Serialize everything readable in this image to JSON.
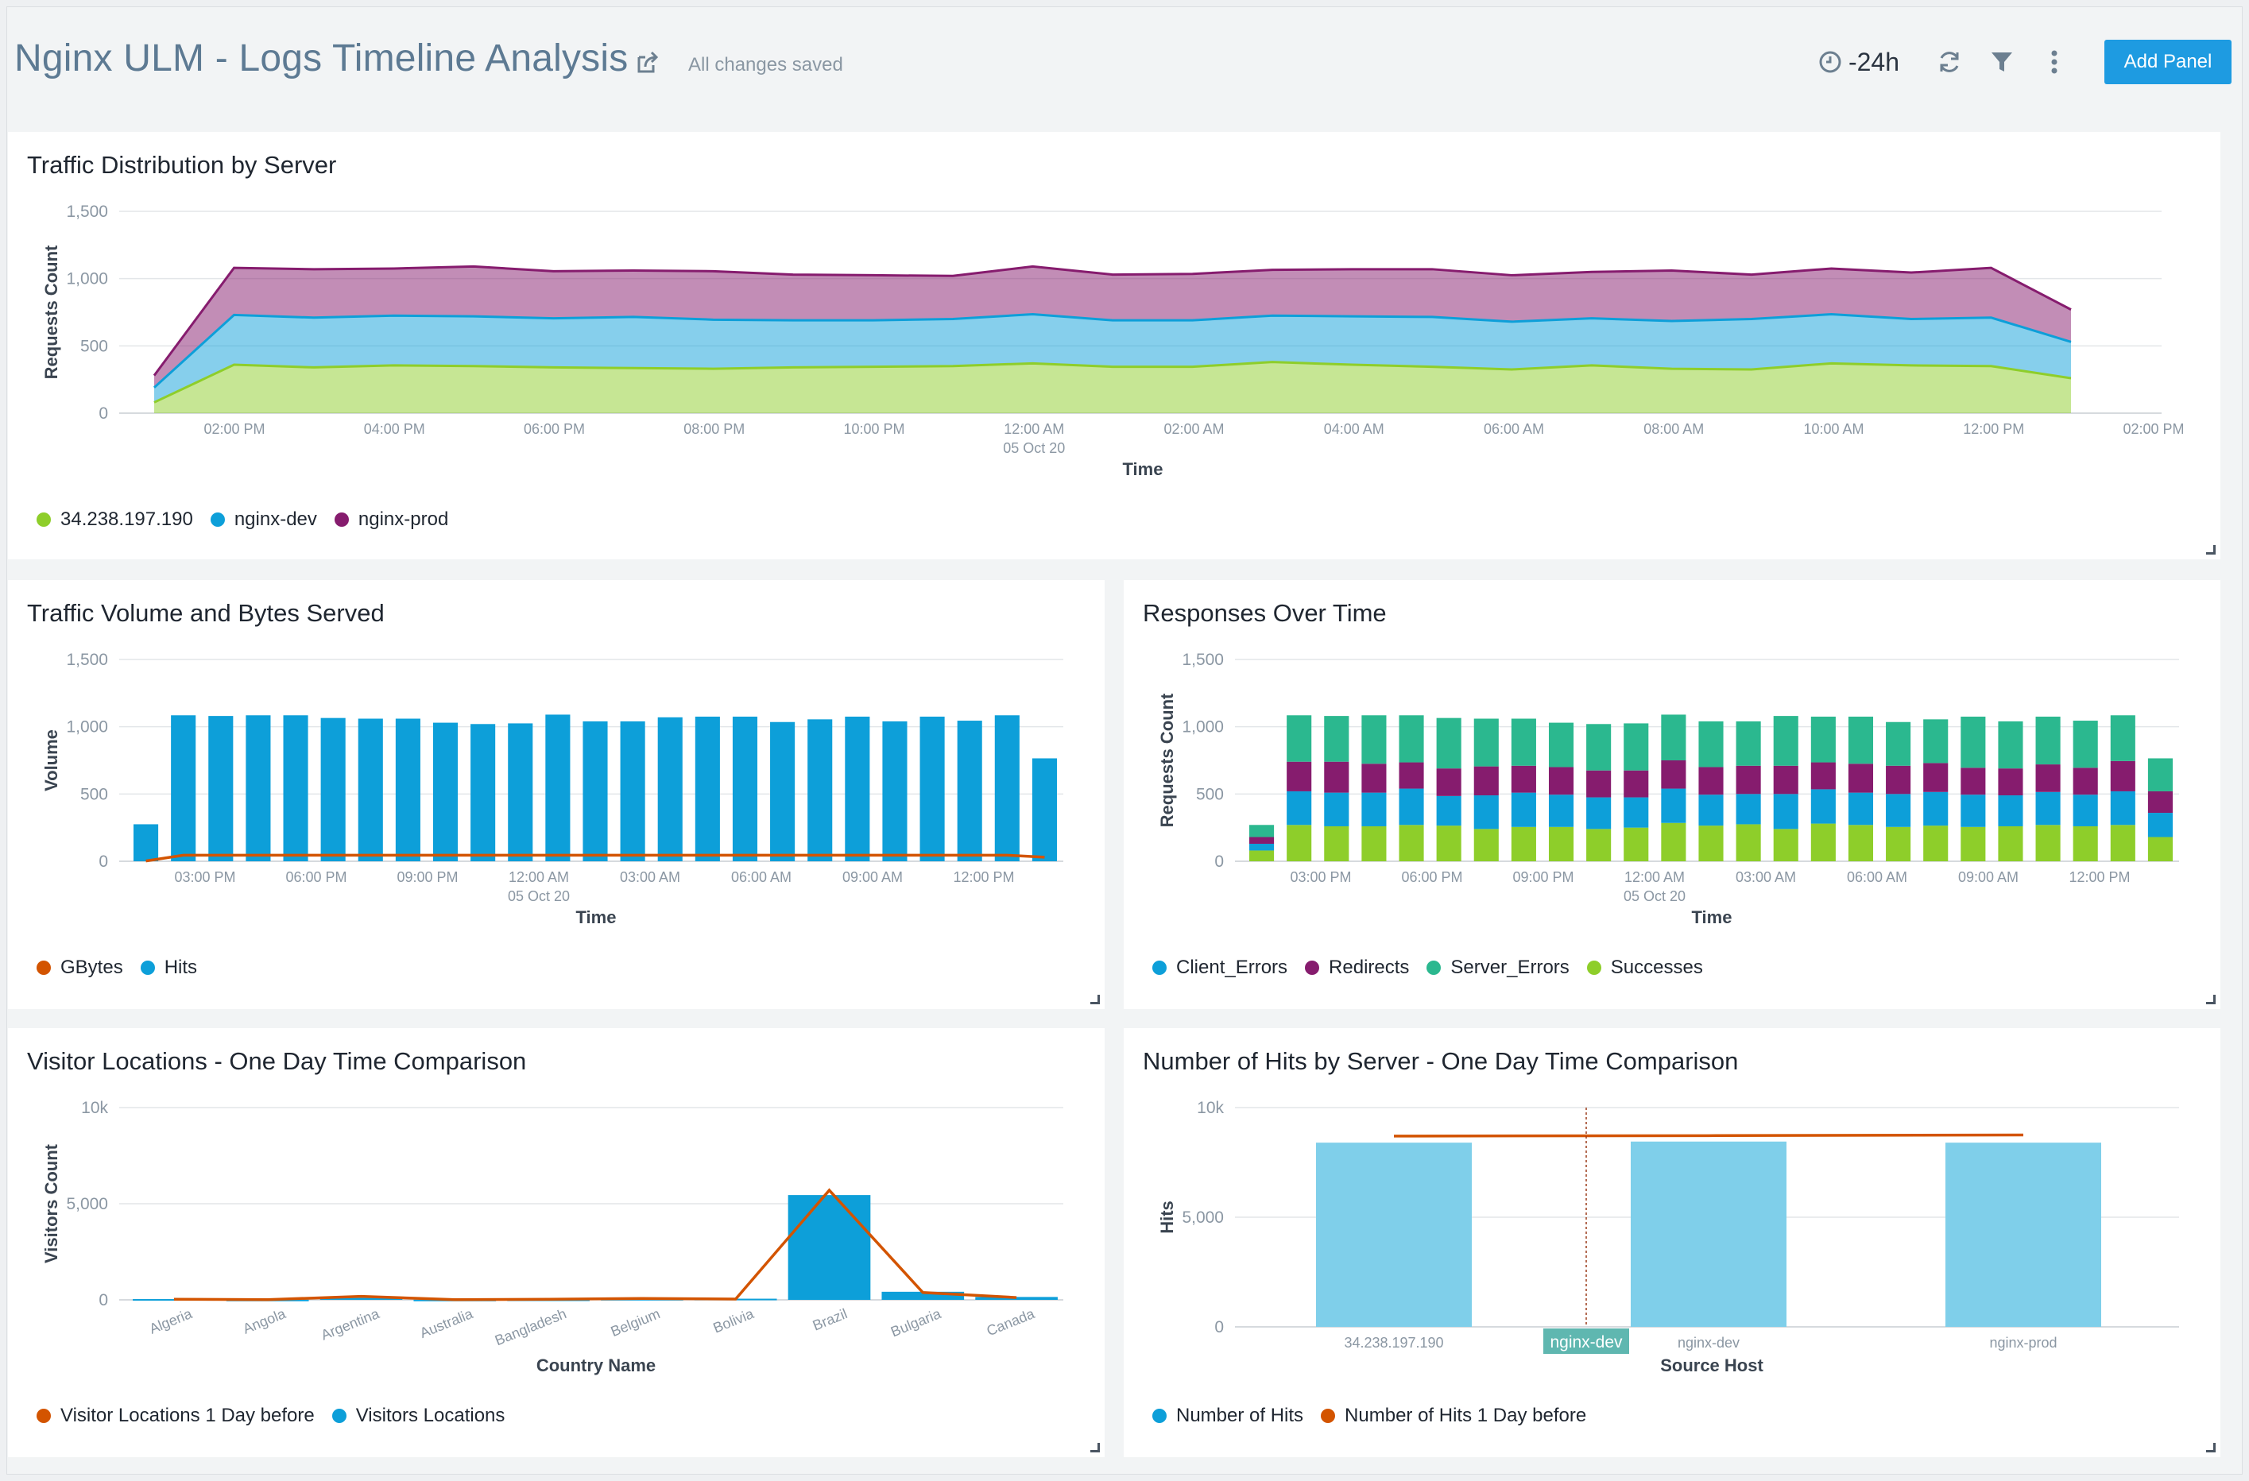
{
  "header": {
    "title": "Nginx ULM - Logs Timeline Analysis",
    "saved_status": "All changes saved",
    "time_range": "-24h",
    "add_panel_label": "Add Panel",
    "icons": [
      "share-icon",
      "clock-icon",
      "refresh-icon",
      "filter-icon",
      "more-vertical-icon"
    ]
  },
  "colors": {
    "accent": "#1e9be1",
    "green": "#8ece2a",
    "blue": "#0d9fd9",
    "purple": "#861c6e",
    "teal": "#2bb88f",
    "orange": "#d35400"
  },
  "chart_data": [
    {
      "id": "traffic-distribution",
      "type": "area",
      "title": "Traffic Distribution by Server",
      "xlabel": "Time",
      "ylabel": "Requests Count",
      "ylim": [
        0,
        1500
      ],
      "yticks": [
        "0",
        "500",
        "1,000",
        "1,500"
      ],
      "xtick_labels": [
        "02:00 PM",
        "04:00 PM",
        "06:00 PM",
        "08:00 PM",
        "10:00 PM",
        "12:00 AM|05 Oct 20",
        "02:00 AM",
        "04:00 AM",
        "06:00 AM",
        "08:00 AM",
        "10:00 AM",
        "12:00 PM",
        "02:00 PM"
      ],
      "x_points": 25,
      "stacked": true,
      "series": [
        {
          "name": "34.238.197.190",
          "color": "#8ece2a",
          "values": [
            80,
            360,
            340,
            355,
            350,
            340,
            335,
            330,
            340,
            345,
            350,
            370,
            345,
            345,
            380,
            360,
            345,
            325,
            355,
            330,
            325,
            370,
            355,
            350,
            260
          ]
        },
        {
          "name": "nginx-dev",
          "color": "#0d9fd9",
          "values": [
            110,
            370,
            370,
            370,
            370,
            365,
            380,
            365,
            350,
            345,
            350,
            365,
            345,
            345,
            345,
            360,
            370,
            355,
            350,
            355,
            375,
            365,
            345,
            360,
            270
          ]
        },
        {
          "name": "nginx-prod",
          "color": "#861c6e",
          "values": [
            90,
            350,
            360,
            350,
            370,
            350,
            345,
            360,
            340,
            335,
            320,
            355,
            340,
            345,
            340,
            350,
            355,
            345,
            345,
            375,
            330,
            340,
            345,
            370,
            240
          ]
        }
      ]
    },
    {
      "id": "traffic-volume",
      "type": "bar",
      "title": "Traffic Volume and Bytes Served",
      "xlabel": "Time",
      "ylabel": "Volume",
      "ylim": [
        0,
        1500
      ],
      "yticks": [
        "0",
        "500",
        "1,000",
        "1,500"
      ],
      "xtick_labels": [
        "03:00 PM",
        "06:00 PM",
        "09:00 PM",
        "12:00 AM|05 Oct 20",
        "03:00 AM",
        "06:00 AM",
        "09:00 AM",
        "12:00 PM"
      ],
      "series": [
        {
          "name": "GBytes",
          "color": "#d35400",
          "kind": "line",
          "values": [
            2,
            45,
            45,
            45,
            45,
            45,
            45,
            45,
            45,
            45,
            45,
            45,
            45,
            45,
            45,
            45,
            45,
            45,
            45,
            45,
            45,
            45,
            45,
            45,
            30
          ]
        },
        {
          "name": "Hits",
          "color": "#0d9fd9",
          "kind": "bar",
          "values": [
            275,
            1085,
            1080,
            1085,
            1085,
            1065,
            1060,
            1060,
            1030,
            1020,
            1025,
            1090,
            1040,
            1040,
            1070,
            1075,
            1075,
            1035,
            1055,
            1075,
            1040,
            1075,
            1045,
            1085,
            765
          ]
        }
      ]
    },
    {
      "id": "responses-over-time",
      "type": "bar",
      "title": "Responses Over Time",
      "xlabel": "Time",
      "ylabel": "Requests Count",
      "ylim": [
        0,
        1500
      ],
      "yticks": [
        "0",
        "500",
        "1,000",
        "1,500"
      ],
      "xtick_labels": [
        "03:00 PM",
        "06:00 PM",
        "09:00 PM",
        "12:00 AM|05 Oct 20",
        "03:00 AM",
        "06:00 AM",
        "09:00 AM",
        "12:00 PM"
      ],
      "stacked": true,
      "series": [
        {
          "name": "Successes",
          "color": "#8ece2a",
          "values": [
            80,
            270,
            260,
            260,
            270,
            265,
            240,
            255,
            255,
            240,
            250,
            285,
            265,
            275,
            240,
            280,
            270,
            255,
            265,
            255,
            260,
            270,
            260,
            270,
            180
          ]
        },
        {
          "name": "Client_Errors",
          "color": "#0d9fd9",
          "values": [
            50,
            250,
            250,
            250,
            270,
            220,
            250,
            255,
            240,
            235,
            225,
            255,
            230,
            225,
            260,
            255,
            240,
            245,
            250,
            240,
            230,
            245,
            235,
            250,
            180
          ]
        },
        {
          "name": "Redirects",
          "color": "#861c6e",
          "values": [
            50,
            220,
            230,
            215,
            195,
            205,
            215,
            200,
            205,
            200,
            200,
            210,
            205,
            210,
            210,
            200,
            215,
            210,
            215,
            200,
            200,
            205,
            200,
            225,
            160
          ]
        },
        {
          "name": "Server_Errors",
          "color": "#2bb88f",
          "values": [
            90,
            345,
            340,
            360,
            350,
            375,
            355,
            350,
            330,
            345,
            350,
            340,
            340,
            330,
            370,
            340,
            350,
            325,
            325,
            380,
            350,
            355,
            350,
            340,
            245
          ]
        }
      ]
    },
    {
      "id": "visitor-locations",
      "type": "bar",
      "title": "Visitor Locations - One Day Time Comparison",
      "xlabel": "Country Name",
      "ylabel": "Visitors Count",
      "ylim": [
        0,
        10000
      ],
      "yticks": [
        "0",
        "5,000",
        "10k"
      ],
      "categories": [
        "Algeria",
        "Angola",
        "Argentina",
        "Australia",
        "Bangladesh",
        "Belgium",
        "Bolivia",
        "Brazil",
        "Bulgaria",
        "Canada"
      ],
      "series": [
        {
          "name": "Visitor Locations 1 Day before",
          "color": "#d35400",
          "kind": "line",
          "values": [
            30,
            10,
            180,
            10,
            30,
            70,
            40,
            5700,
            380,
            120
          ]
        },
        {
          "name": "Visitors Locations",
          "color": "#0d9fd9",
          "kind": "bar",
          "values": [
            40,
            10,
            100,
            10,
            20,
            50,
            60,
            5450,
            420,
            150
          ]
        }
      ]
    },
    {
      "id": "hits-by-server",
      "type": "bar",
      "title": "Number of Hits by Server - One Day Time Comparison",
      "xlabel": "Source Host",
      "ylabel": "Hits",
      "ylim": [
        0,
        10000
      ],
      "yticks": [
        "0",
        "5,000",
        "10k"
      ],
      "categories": [
        "34.238.197.190",
        "nginx-dev",
        "nginx-prod"
      ],
      "hover_label": "nginx-dev",
      "series": [
        {
          "name": "Number of Hits",
          "color": "#7fcfea",
          "kind": "bar",
          "values": [
            8400,
            8450,
            8400
          ]
        },
        {
          "name": "Number of Hits 1 Day before",
          "color": "#d35400",
          "kind": "line",
          "values": [
            8700,
            8720,
            8750
          ]
        }
      ]
    }
  ],
  "legends": {
    "traffic_distribution": [
      {
        "label": "34.238.197.190",
        "color": "#8ece2a"
      },
      {
        "label": "nginx-dev",
        "color": "#0d9fd9"
      },
      {
        "label": "nginx-prod",
        "color": "#861c6e"
      }
    ],
    "traffic_volume": [
      {
        "label": "GBytes",
        "color": "#d35400"
      },
      {
        "label": "Hits",
        "color": "#0d9fd9"
      }
    ],
    "responses": [
      {
        "label": "Client_Errors",
        "color": "#0d9fd9"
      },
      {
        "label": "Redirects",
        "color": "#861c6e"
      },
      {
        "label": "Server_Errors",
        "color": "#2bb88f"
      },
      {
        "label": "Successes",
        "color": "#8ece2a"
      }
    ],
    "visitor_locations": [
      {
        "label": "Visitor Locations 1 Day before",
        "color": "#d35400"
      },
      {
        "label": "Visitors Locations",
        "color": "#0d9fd9"
      }
    ],
    "hits_by_server": [
      {
        "label": "Number of Hits",
        "color": "#0d9fd9"
      },
      {
        "label": "Number of Hits 1 Day before",
        "color": "#d35400"
      }
    ]
  }
}
